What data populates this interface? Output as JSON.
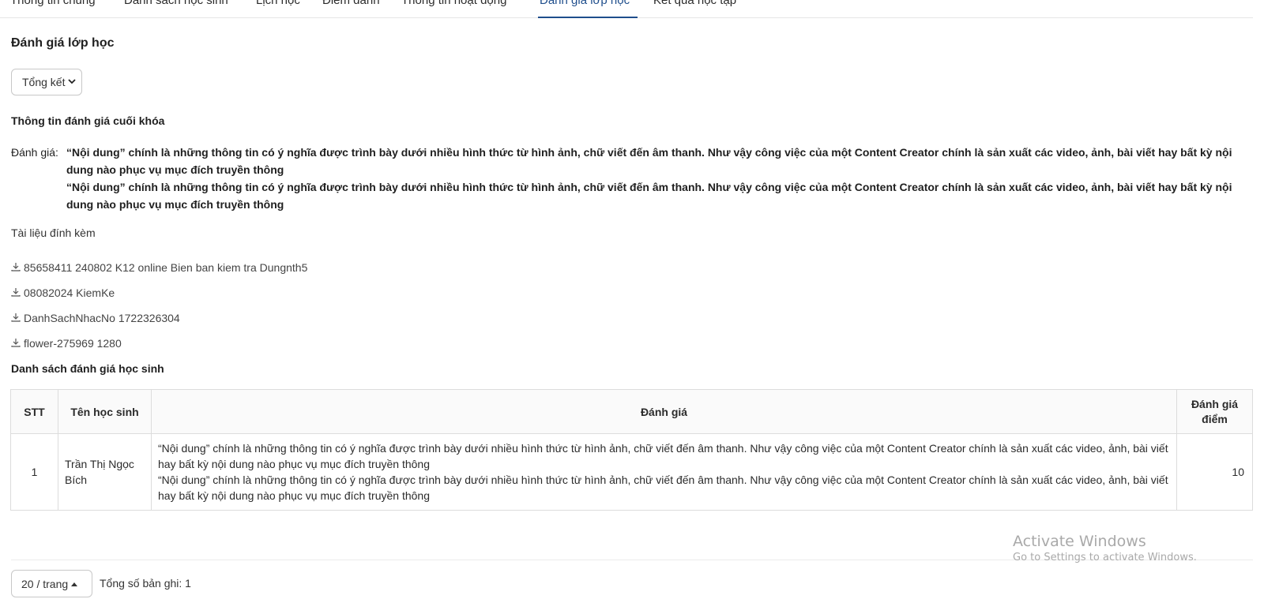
{
  "tabs": [
    {
      "label": "Thông tin chung"
    },
    {
      "label": "Danh sách học sinh"
    },
    {
      "label": "Lịch học"
    },
    {
      "label": "Điểm danh"
    },
    {
      "label": "Thông tin hoạt động"
    },
    {
      "label": "Đánh giá lớp học",
      "active": true
    },
    {
      "label": "Kết quả học tập"
    }
  ],
  "page_title": "Đánh giá lớp học",
  "filter": {
    "selected": "Tổng kết"
  },
  "final_eval": {
    "title": "Thông tin đánh giá cuối khóa",
    "label": "Đánh giá:",
    "lines": [
      "“Nội dung” chính là những thông tin có ý nghĩa được trình bày dưới nhiều hình thức từ hình ảnh, chữ viết đến âm thanh. Như vậy công việc của một Content Creator chính là sản xuất các video, ảnh, bài viết hay bất kỳ nội dung nào phục vụ mục đích truyền thông",
      "“Nội dung” chính là những thông tin có ý nghĩa được trình bày dưới nhiều hình thức từ hình ảnh, chữ viết đến âm thanh. Như vậy công việc của một Content Creator chính là sản xuất các video, ảnh, bài viết hay bất kỳ nội dung nào phục vụ mục đích truyền thông"
    ]
  },
  "attachments": {
    "label": "Tài liệu đính kèm",
    "items": [
      "85658411 240802 K12 online Bien ban kiem tra Dungnth5",
      "08082024 KiemKe",
      "DanhSachNhacNo 1722326304",
      "flower-275969 1280"
    ]
  },
  "student_list": {
    "title": "Danh sách đánh giá học sinh",
    "headers": {
      "stt": "STT",
      "name": "Tên học sinh",
      "eval": "Đánh giá",
      "score": "Đánh giá điểm"
    },
    "rows": [
      {
        "stt": "1",
        "name": "Trần Thị Ngọc Bích",
        "eval_lines": [
          "“Nội dung” chính là những thông tin có ý nghĩa được trình bày dưới nhiều hình thức từ hình ảnh, chữ viết đến âm thanh. Như vậy công việc của một Content Creator chính là sản xuất các video, ảnh, bài viết hay bất kỳ nội dung nào phục vụ mục đích truyền thông",
          "“Nội dung” chính là những thông tin có ý nghĩa được trình bày dưới nhiều hình thức từ hình ảnh, chữ viết đến âm thanh. Như vậy công việc của một Content Creator chính là sản xuất các video, ảnh, bài viết hay bất kỳ nội dung nào phục vụ mục đích truyền thông"
        ],
        "score": "10"
      }
    ]
  },
  "pagination": {
    "page_size": "20 / trang",
    "total": "Tổng số bản ghi: 1"
  },
  "watermark": {
    "line1": "Activate Windows",
    "line2": "Go to Settings to activate Windows."
  },
  "colors": {
    "accent": "#1f4e8c",
    "border": "#dcdcdc"
  }
}
